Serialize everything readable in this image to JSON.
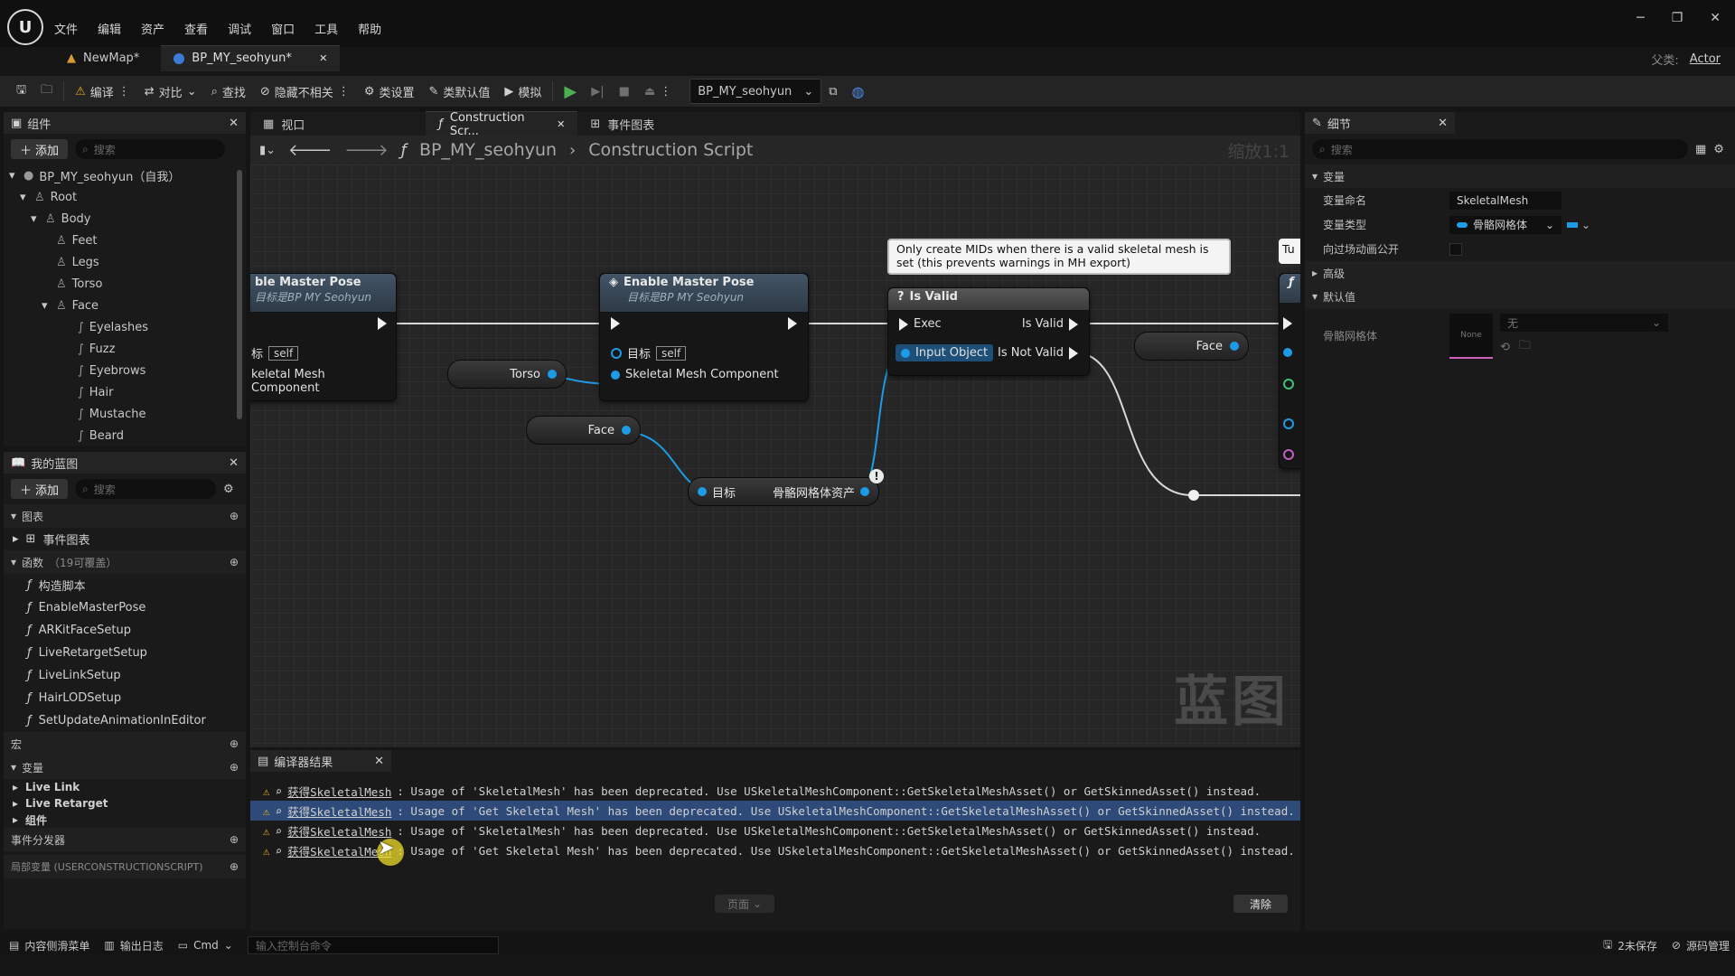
{
  "menu": [
    "文件",
    "编辑",
    "资产",
    "查看",
    "调试",
    "窗口",
    "工具",
    "帮助"
  ],
  "tabs": [
    {
      "label": "NewMap*"
    },
    {
      "label": "BP_MY_seohyun*"
    }
  ],
  "window": {
    "parent_label": "父类:",
    "parent_value": "Actor"
  },
  "toolbar": {
    "compile": "编译",
    "diff": "对比",
    "find": "查找",
    "hide_unrelated": "隐藏不相关",
    "class_settings": "类设置",
    "class_defaults": "类默认值",
    "simulate": "模拟",
    "debug_object": "BP_MY_seohyun"
  },
  "components": {
    "title": "组件",
    "add": "添加",
    "search_placeholder": "搜索",
    "tree": [
      {
        "label": "BP_MY_seohyun（自我）",
        "depth": 0,
        "icon": "person-icon"
      },
      {
        "label": "Root",
        "depth": 1,
        "icon": "skeleton-icon"
      },
      {
        "label": "Body",
        "depth": 2,
        "icon": "skeleton-icon"
      },
      {
        "label": "Feet",
        "depth": 3,
        "icon": "skeleton-icon"
      },
      {
        "label": "Legs",
        "depth": 3,
        "icon": "skeleton-icon"
      },
      {
        "label": "Torso",
        "depth": 3,
        "icon": "skeleton-icon"
      },
      {
        "label": "Face",
        "depth": 3,
        "icon": "skeleton-icon"
      },
      {
        "label": "Eyelashes",
        "depth": 4,
        "icon": "groom-icon"
      },
      {
        "label": "Fuzz",
        "depth": 4,
        "icon": "groom-icon"
      },
      {
        "label": "Eyebrows",
        "depth": 4,
        "icon": "groom-icon"
      },
      {
        "label": "Hair",
        "depth": 4,
        "icon": "groom-icon"
      },
      {
        "label": "Mustache",
        "depth": 4,
        "icon": "groom-icon"
      },
      {
        "label": "Beard",
        "depth": 4,
        "icon": "groom-icon"
      }
    ]
  },
  "my_blueprint": {
    "title": "我的蓝图",
    "add": "添加",
    "search_placeholder": "搜索",
    "graphs_label": "图表",
    "event_graph": "事件图表",
    "functions_label": "函数",
    "functions_count": "（19可覆盖）",
    "functions": [
      "构造脚本",
      "EnableMasterPose",
      "ARKitFaceSetup",
      "LiveRetargetSetup",
      "LiveLinkSetup",
      "HairLODSetup",
      "SetUpdateAnimationInEditor"
    ],
    "macros_label": "宏",
    "variables_label": "变量",
    "variable_groups": [
      "Live Link",
      "Live Retarget",
      "组件"
    ],
    "dispatchers_label": "事件分发器",
    "local_vars_label": "局部变量 (USERCONSTRUCTIONSCRIPT)"
  },
  "graph_tabs": [
    {
      "label": "视口"
    },
    {
      "label": "Construction Scr..."
    },
    {
      "label": "事件图表"
    }
  ],
  "breadcrumb": {
    "root": "BP_MY_seohyun",
    "current": "Construction Script",
    "zoom": "缩放1:1"
  },
  "nodes": {
    "emp1": {
      "title": "ble Master Pose",
      "subtitle": "目标是BP MY Seohyun",
      "target": "标",
      "self": "self",
      "mesh": "keletal Mesh Component"
    },
    "emp2": {
      "title": "Enable Master Pose",
      "subtitle": "目标是BP MY Seohyun",
      "target": "目标",
      "self": "self",
      "mesh": "Skeletal Mesh Component"
    },
    "torso": "Torso",
    "face1": "Face",
    "face2": "Face",
    "getmesh": {
      "target": "目标",
      "out": "骨骼网格体资产"
    },
    "comment": "Only create MIDs when there is a valid skeletal mesh is set (this prevents warnings in MH export)",
    "isvalid": {
      "title": "Is Valid",
      "exec": "Exec",
      "input": "Input Object",
      "valid": "Is Valid",
      "notvalid": "Is Not Valid"
    },
    "partial": "Tu",
    "watermark": "蓝图"
  },
  "details": {
    "title": "细节",
    "search_placeholder": "搜索",
    "variable_section": "变量",
    "var_name_label": "变量命名",
    "var_name": "SkeletalMesh",
    "var_type_label": "变量类型",
    "var_type": "骨骼网格体",
    "expose_label": "向过场动画公开",
    "advanced": "高级",
    "default_section": "默认值",
    "default_label": "骨骼网格体",
    "default_thumb": "None",
    "default_value": "无"
  },
  "compiler": {
    "title": "编译器结果",
    "lines": [
      {
        "link": "获得SkeletalMesh",
        "msg": ": Usage of 'SkeletalMesh' has been deprecated. Use USkeletalMeshComponent::GetSkeletalMeshAsset() or GetSkinnedAsset() instead."
      },
      {
        "link": "获得SkeletalMesh",
        "msg": ": Usage of 'Get Skeletal Mesh' has been deprecated. Use USkeletalMeshComponent::GetSkeletalMeshAsset() or GetSkinnedAsset() instead."
      },
      {
        "link": "获得SkeletalMesh",
        "msg": ": Usage of 'SkeletalMesh' has been deprecated. Use USkeletalMeshComponent::GetSkeletalMeshAsset() or GetSkinnedAsset() instead."
      },
      {
        "link": "获得SkeletalMesh",
        "msg": ": Usage of 'Get Skeletal Mesh' has been deprecated. Use USkeletalMeshComponent::GetSkeletalMeshAsset() or GetSkinnedAsset() instead."
      }
    ],
    "page": "页面",
    "clear": "清除"
  },
  "statusbar": {
    "content_drawer": "内容侧滑菜单",
    "output_log": "输出日志",
    "cmd": "Cmd",
    "console_placeholder": "输入控制台命令",
    "unsaved": "2未保存",
    "source_control": "源码管理"
  },
  "colors": {
    "accent": "#1e9be6",
    "warning": "#e8b020",
    "selection": "#2d4a78",
    "play": "#4caf50"
  }
}
